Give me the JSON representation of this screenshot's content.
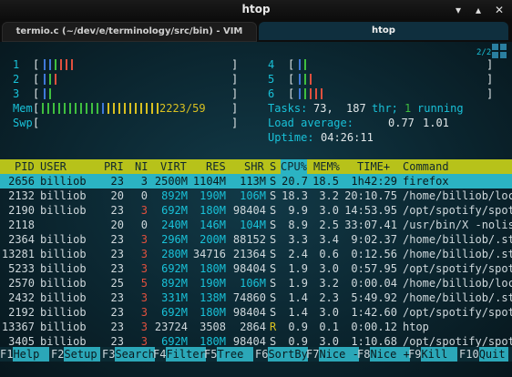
{
  "window": {
    "title": "htop"
  },
  "tabs": [
    {
      "label": "termio.c (~/dev/e/terminology/src/bin) - VIM"
    },
    {
      "label": "htop"
    }
  ],
  "meters": {
    "cpu_labels": [
      "1",
      "2",
      "3",
      "4",
      "5",
      "6"
    ],
    "mem_label": "Mem",
    "mem_value": "2223/59",
    "swp_label": "Swp",
    "tasks_label": "Tasks:",
    "tasks_value": "73,",
    "thr_value": "187",
    "thr_label": "thr;",
    "running_value": "1",
    "running_label": "running",
    "load_label": "Load average:",
    "load_1": "0.77",
    "load_2": "1.01",
    "uptime_label": "Uptime:",
    "uptime_value": "04:26:11",
    "corner_label": "2/2"
  },
  "table": {
    "headers": [
      "PID",
      "USER",
      "PRI",
      "NI",
      "VIRT",
      "RES",
      "SHR",
      "S",
      "CPU%",
      "MEM%",
      "TIME+",
      "Command"
    ],
    "rows": [
      [
        "2656",
        "billiob",
        "23",
        "3",
        "2500M",
        "1104M",
        "113M",
        "S",
        "20.7",
        "18.5",
        "1h42:29",
        "firefox"
      ],
      [
        "2132",
        "billiob",
        "20",
        "0",
        "892M",
        "190M",
        "106M",
        "S",
        "18.3",
        "3.2",
        "20:10.75",
        "/home/billiob/loc"
      ],
      [
        "2190",
        "billiob",
        "23",
        "3",
        "692M",
        "180M",
        "98404",
        "S",
        "9.9",
        "3.0",
        "14:53.95",
        "/opt/spotify/spot"
      ],
      [
        "2118",
        "",
        "20",
        "0",
        "240M",
        "146M",
        "104M",
        "S",
        "8.9",
        "2.5",
        "33:07.41",
        "/usr/bin/X -nolis"
      ],
      [
        "2364",
        "billiob",
        "23",
        "3",
        "296M",
        "200M",
        "88152",
        "S",
        "3.3",
        "3.4",
        "9:02.37",
        "/home/billiob/.st"
      ],
      [
        "13281",
        "billiob",
        "23",
        "3",
        "280M",
        "34716",
        "21364",
        "S",
        "2.4",
        "0.6",
        "0:12.56",
        "/home/billiob/.st"
      ],
      [
        "5233",
        "billiob",
        "23",
        "3",
        "692M",
        "180M",
        "98404",
        "S",
        "1.9",
        "3.0",
        "0:57.95",
        "/opt/spotify/spot"
      ],
      [
        "2570",
        "billiob",
        "25",
        "5",
        "892M",
        "190M",
        "106M",
        "S",
        "1.9",
        "3.2",
        "0:00.04",
        "/home/billiob/loc"
      ],
      [
        "2432",
        "billiob",
        "23",
        "3",
        "331M",
        "138M",
        "74860",
        "S",
        "1.4",
        "2.3",
        "5:49.92",
        "/home/billiob/.st"
      ],
      [
        "2192",
        "billiob",
        "23",
        "3",
        "692M",
        "180M",
        "98404",
        "S",
        "1.4",
        "3.0",
        "1:42.60",
        "/opt/spotify/spot"
      ],
      [
        "13367",
        "billiob",
        "23",
        "3",
        "23724",
        "3508",
        "2864",
        "R",
        "0.9",
        "0.1",
        "0:00.12",
        "htop"
      ],
      [
        "3405",
        "billiob",
        "23",
        "3",
        "692M",
        "180M",
        "98404",
        "S",
        "0.9",
        "3.0",
        "1:10.68",
        "/opt/spotify/spot"
      ]
    ]
  },
  "function_keys": [
    {
      "key": "F1",
      "label": "Help"
    },
    {
      "key": "F2",
      "label": "Setup"
    },
    {
      "key": "F3",
      "label": "Search"
    },
    {
      "key": "F4",
      "label": "Filter"
    },
    {
      "key": "F5",
      "label": "Tree"
    },
    {
      "key": "F6",
      "label": "SortBy"
    },
    {
      "key": "F7",
      "label": "Nice -"
    },
    {
      "key": "F8",
      "label": "Nice +"
    },
    {
      "key": "F9",
      "label": "Kill"
    },
    {
      "key": "F10",
      "label": "Quit"
    }
  ],
  "colors": {
    "terminal_bg": "#0b2630",
    "header_bg": "#b7c21a",
    "selection_bg": "#2bb3c3",
    "accent_cyan": "#19c1d8",
    "nice_red": "#e0503e"
  }
}
